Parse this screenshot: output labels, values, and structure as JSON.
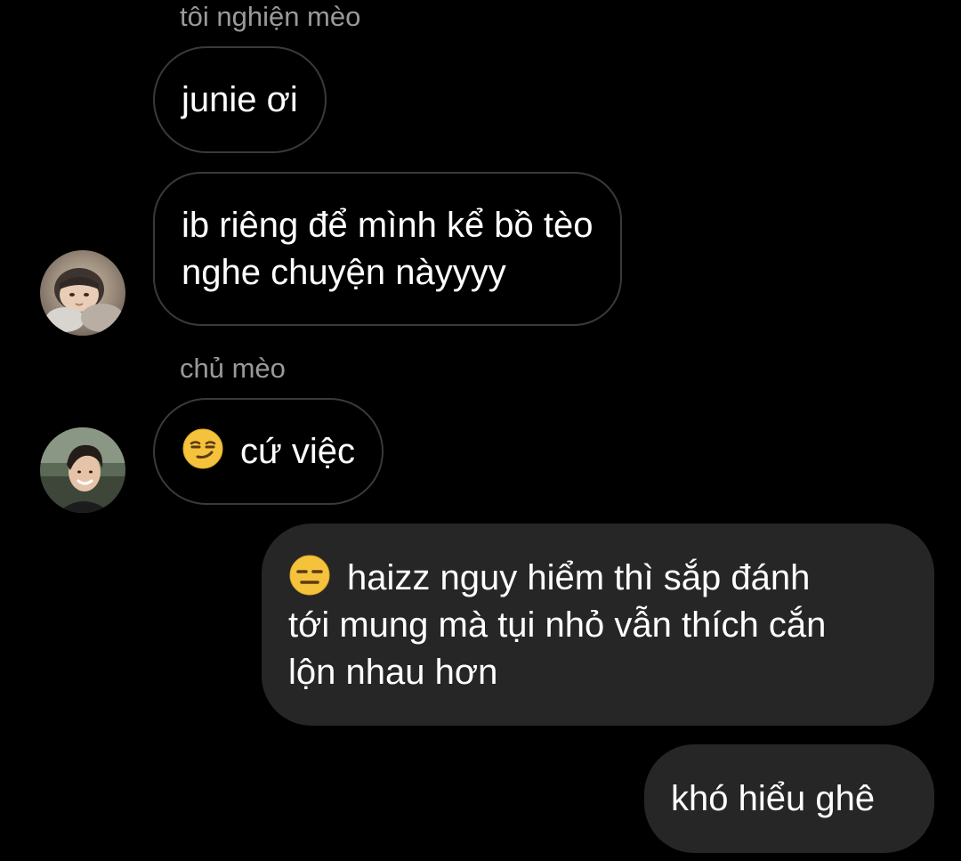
{
  "thread": {
    "groups": [
      {
        "sender_name": "tôi nghiện mèo",
        "avatar_icon": "avatar-photo-bundled-up",
        "messages": [
          {
            "lines": [
              "junie ơi"
            ]
          },
          {
            "lines": [
              "ib riêng để mình kể bồ tèo",
              "nghe chuyện nàyyyy"
            ]
          }
        ]
      },
      {
        "sender_name": "chủ mèo",
        "avatar_icon": "avatar-photo-smiling-man",
        "messages": [
          {
            "emoji": "smirking-face-emoji",
            "text": "cứ việc"
          }
        ]
      }
    ],
    "outgoing": [
      {
        "emoji": "expressionless-face-emoji",
        "lines": [
          "haizz nguy hiểm thì sắp đánh",
          "tới mung mà tụi nhỏ vẫn thích cắn",
          "lộn nhau hơn"
        ]
      },
      {
        "lines": [
          "khó hiểu ghê"
        ]
      }
    ]
  },
  "colors": {
    "background": "#000000",
    "incoming_bubble_border": "#3a3a3a",
    "outgoing_bubble_fill": "#262626",
    "sender_name_text": "#9a9a9a",
    "message_text": "#ffffff"
  }
}
